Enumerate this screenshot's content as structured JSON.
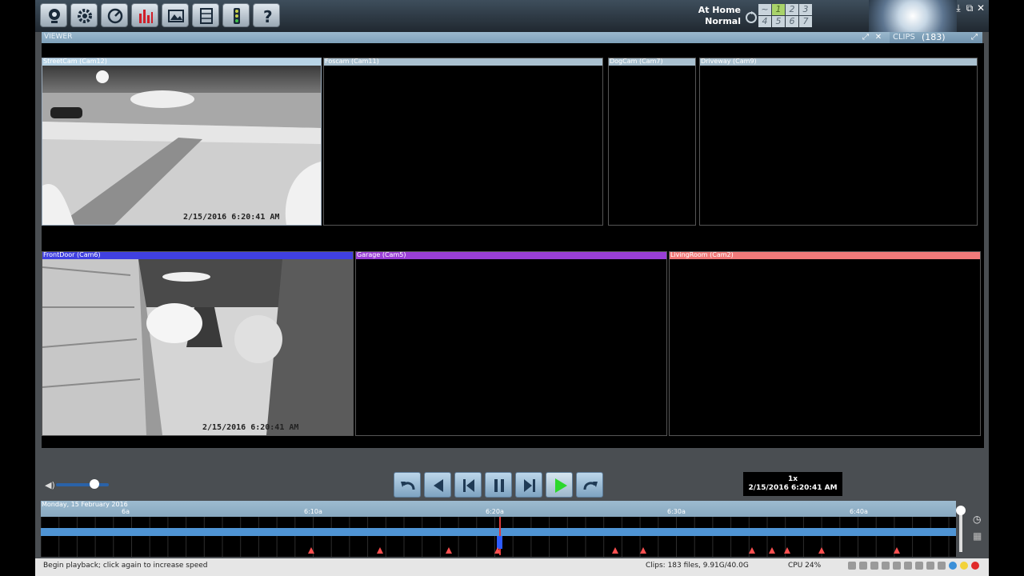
{
  "toolbar": {
    "buttons": [
      {
        "name": "cameras-button",
        "icon": "camera-icon"
      },
      {
        "name": "settings-button",
        "icon": "gear-icon"
      },
      {
        "name": "status-button",
        "icon": "globe-icon"
      },
      {
        "name": "stats-button",
        "icon": "bar-chart-icon"
      },
      {
        "name": "images-button",
        "icon": "image-icon"
      },
      {
        "name": "clips-button",
        "icon": "film-icon"
      },
      {
        "name": "traffic-button",
        "icon": "traffic-light-icon"
      },
      {
        "name": "help-button",
        "icon": "question-icon"
      }
    ],
    "profile_name": "At Home",
    "profile_state": "Normal",
    "profile_numbers": [
      "~",
      "1",
      "2",
      "3",
      "4",
      "5",
      "6",
      "7"
    ]
  },
  "viewer": {
    "title": "VIEWER"
  },
  "clips": {
    "title": "CLIPS",
    "count": "(183)"
  },
  "cameras": [
    {
      "name": "StreetCam (Cam12)",
      "color": "#b8d4e6",
      "timestamp": "2/15/2016 6:20:41 AM",
      "live": true
    },
    {
      "name": "Foscam (Cam11)",
      "color": "#a9c0cf",
      "timestamp": "",
      "live": false
    },
    {
      "name": "DogCam (Cam7)",
      "color": "#a9c0cf",
      "timestamp": "",
      "live": false
    },
    {
      "name": "Driveway (Cam9)",
      "color": "#a9c0cf",
      "timestamp": "",
      "live": false
    },
    {
      "name": "FrontDoor (Cam6)",
      "color": "#4040e0",
      "timestamp": "2/15/2016 6:20:41 AM",
      "live": true
    },
    {
      "name": "Garage (Cam5)",
      "color": "#9a3fd6",
      "timestamp": "",
      "live": false
    },
    {
      "name": "LivingRoom (Cam2)",
      "color": "#f07a7a",
      "timestamp": "",
      "live": false
    }
  ],
  "transport": {
    "buttons": [
      "undo-button",
      "rewind-button",
      "skip-back-button",
      "pause-button",
      "skip-forward-button",
      "play-button",
      "redo-button"
    ],
    "speed": "1x",
    "time": "2/15/2016 6:20:41 AM"
  },
  "timeline": {
    "date": "Monday, 15 February 2016",
    "ticks": [
      "6a",
      "6:10a",
      "6:20a",
      "6:30a",
      "6:40a"
    ],
    "marker_count": 13
  },
  "status": {
    "message": "Begin playback; click again to increase speed",
    "clips": "Clips: 183 files, 9.91G/40.0G",
    "cpu": "CPU 24%"
  },
  "colors": {
    "toolbar_bg": "#2a3844",
    "header_blue": "#8fb0c8",
    "timeline_bar": "#4f94d4",
    "marker_red": "#ff5050"
  }
}
